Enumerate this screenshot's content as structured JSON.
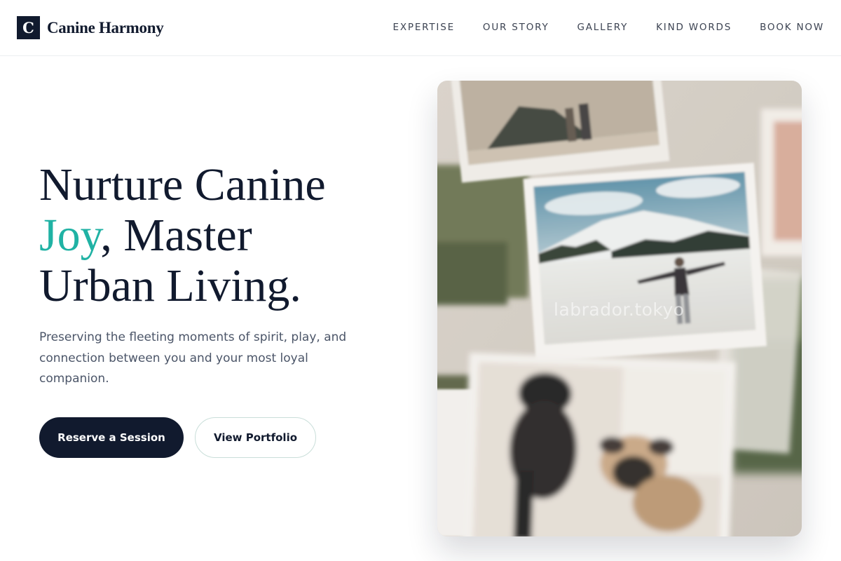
{
  "brand": {
    "logo_letter": "C",
    "name": "Canine Harmony"
  },
  "nav": {
    "links": [
      "EXPERTISE",
      "OUR STORY",
      "GALLERY",
      "KIND WORDS",
      "BOOK NOW"
    ]
  },
  "hero": {
    "title_line1": "Nurture Canine",
    "title_accent": "Joy",
    "title_rest": ", Master",
    "title_line3": "Urban Living.",
    "subtitle": "Preserving the fleeting moments of spirit, play, and connection between you and your most loyal companion.",
    "primary_button": "Reserve a Session",
    "secondary_button": "View Portfolio"
  },
  "photo": {
    "watermark": "labrador.tokyo"
  },
  "colors": {
    "navy": "#111a2e",
    "accent": "#20b2a4",
    "text_muted": "#4b5568"
  }
}
